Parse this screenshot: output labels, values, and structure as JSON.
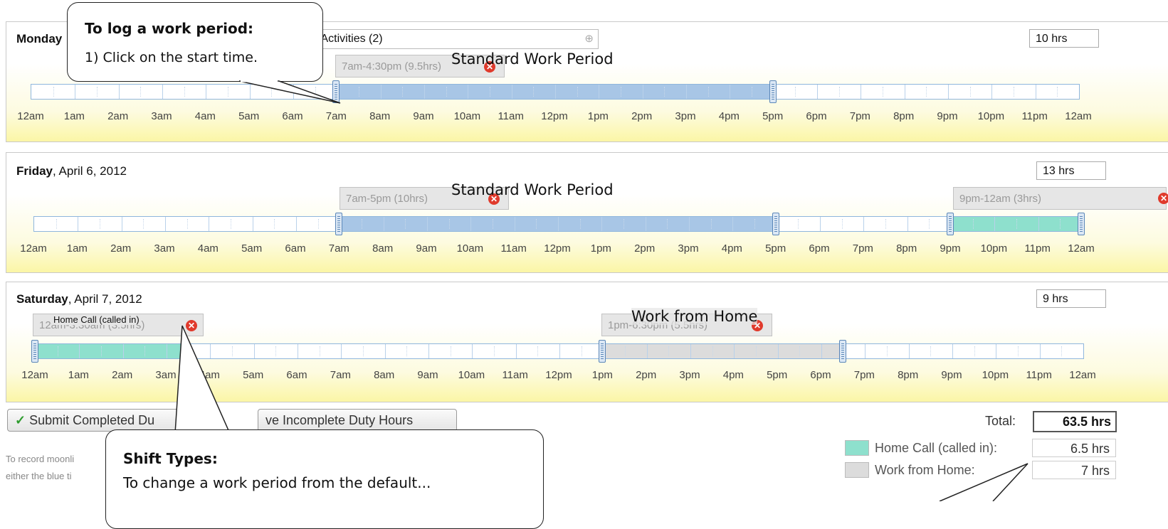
{
  "days": [
    {
      "day_name": "Monday",
      "date": "",
      "activities_label": "d Activities (2)",
      "total_hours": "10 hrs",
      "periods": [
        {
          "label": "7am-4:30pm (9.5hrs)"
        }
      ],
      "overlay_label": "Standard Work Period"
    },
    {
      "day_name": "Friday",
      "date": ", April 6, 2012",
      "total_hours": "13 hrs",
      "periods": [
        {
          "label": "7am-5pm (10hrs)"
        },
        {
          "label": "9pm-12am (3hrs)"
        }
      ],
      "overlay_label": "Standard Work Period"
    },
    {
      "day_name": "Saturday",
      "date": ", April 7, 2012",
      "total_hours": "9 hrs",
      "periods": [
        {
          "label": "12am-3:30am (3.5hrs)"
        },
        {
          "label": "1pm-6:30pm (5.5hrs)"
        }
      ],
      "period_caption": "Home Call (called in)",
      "overlay_label": "Work from Home"
    }
  ],
  "hour_labels": [
    "12am",
    "1am",
    "2am",
    "3am",
    "4am",
    "5am",
    "6am",
    "7am",
    "8am",
    "9am",
    "10am",
    "11am",
    "12pm",
    "1pm",
    "2pm",
    "3pm",
    "4pm",
    "5pm",
    "6pm",
    "7pm",
    "8pm",
    "9pm",
    "10pm",
    "11pm",
    "12am"
  ],
  "callouts": {
    "log_period_title": "To log a work period:",
    "log_period_step": "1) Click on the start time.",
    "shift_types_title": "Shift Types:",
    "shift_types_text": "To change a work period from the default..."
  },
  "buttons": {
    "submit_label": "Submit Completed Du",
    "save_label": "ve Incomplete Duty Hours"
  },
  "summary": {
    "total_label": "Total:",
    "total_value": "63.5 hrs",
    "legend": [
      {
        "label": "Home Call (called in):",
        "value": "6.5 hrs",
        "color": "#8ee0cd"
      },
      {
        "label": "Work from Home:",
        "value": "7 hrs",
        "color": "#dcdcdc"
      }
    ]
  },
  "footnote": {
    "line1": "To record moonli",
    "line2": "either the blue ti"
  },
  "colors": {
    "standard": "#a8c6e6",
    "home_call": "#8ee0cd",
    "work_from_home": "#dcdcdc"
  }
}
